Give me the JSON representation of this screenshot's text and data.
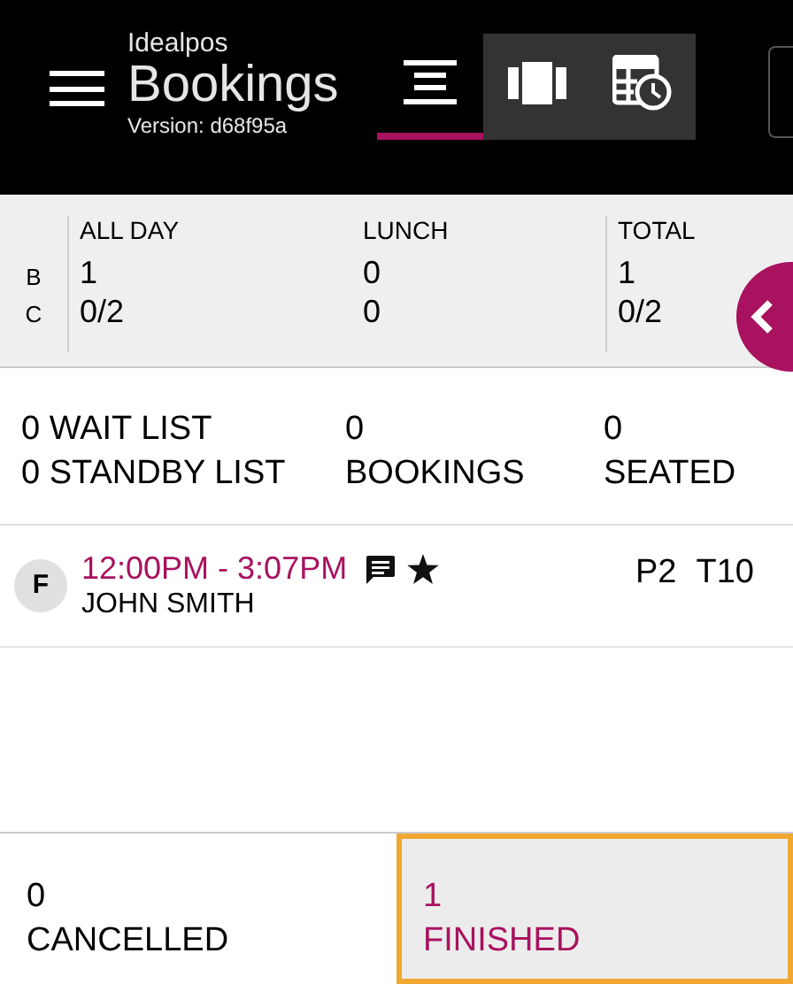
{
  "header": {
    "app_name": "Idealpos",
    "title": "Bookings",
    "version": "Version: d68f95a"
  },
  "view_tabs": [
    {
      "kind": "list",
      "selected": true
    },
    {
      "kind": "floor",
      "selected": false
    },
    {
      "kind": "timeline",
      "selected": false
    }
  ],
  "summary": {
    "row_labels": [
      "B",
      "C"
    ],
    "columns": [
      {
        "heading": "ALL DAY",
        "values": [
          "1",
          "0/2"
        ]
      },
      {
        "heading": "LUNCH",
        "values": [
          "0",
          "0"
        ]
      },
      {
        "heading": "TOTAL",
        "values": [
          "1",
          "0/2"
        ]
      }
    ]
  },
  "counts": [
    {
      "lines": [
        "0 WAIT LIST",
        "0 STANDBY LIST"
      ]
    },
    {
      "lines": [
        "0",
        "BOOKINGS"
      ]
    },
    {
      "lines": [
        "0",
        "SEATED"
      ]
    }
  ],
  "bookings": [
    {
      "badge": "F",
      "time": "12:00PM - 3:07PM",
      "name": "JOHN SMITH",
      "has_note": true,
      "starred": true,
      "pax": "P2",
      "table": "T10"
    }
  ],
  "footer_tabs": [
    {
      "count": "0",
      "label": "CANCELLED",
      "selected": false
    },
    {
      "count": "1",
      "label": "FINISHED",
      "selected": true
    }
  ]
}
